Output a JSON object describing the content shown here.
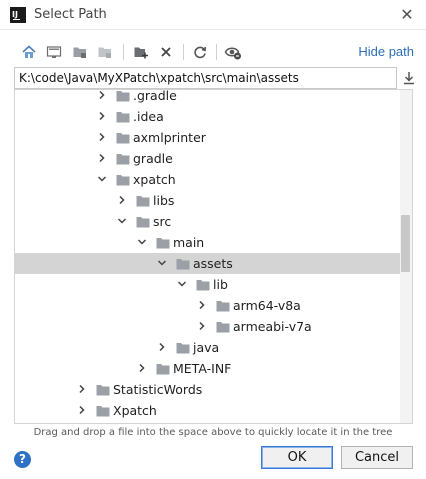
{
  "window": {
    "app_icon_text": "IJ",
    "title": "Select Path",
    "close_glyph": "✕"
  },
  "toolbar": {
    "buttons": [
      {
        "icon": "home-icon",
        "enabled": true
      },
      {
        "icon": "desktop-icon",
        "enabled": true
      },
      {
        "icon": "project-folder-icon",
        "enabled": false
      },
      {
        "icon": "module-folder-icon",
        "enabled": false
      },
      {
        "icon": "new-folder-icon",
        "enabled": true
      },
      {
        "icon": "delete-icon",
        "enabled": true
      },
      {
        "icon": "refresh-icon",
        "enabled": true
      },
      {
        "icon": "show-hidden-files-icon",
        "enabled": true
      }
    ],
    "hide_path_label": "Hide path"
  },
  "path": {
    "value": "K:\\code\\Java\\MyXPatch\\xpatch\\src\\main\\assets"
  },
  "tree": {
    "items": [
      {
        "label": ".gradle",
        "depth": 0,
        "expanded": false,
        "selected": false
      },
      {
        "label": ".idea",
        "depth": 0,
        "expanded": false,
        "selected": false
      },
      {
        "label": "axmlprinter",
        "depth": 0,
        "expanded": false,
        "selected": false
      },
      {
        "label": "gradle",
        "depth": 0,
        "expanded": false,
        "selected": false
      },
      {
        "label": "xpatch",
        "depth": 0,
        "expanded": true,
        "selected": false
      },
      {
        "label": "libs",
        "depth": 1,
        "expanded": false,
        "selected": false
      },
      {
        "label": "src",
        "depth": 1,
        "expanded": true,
        "selected": false
      },
      {
        "label": "main",
        "depth": 2,
        "expanded": true,
        "selected": false
      },
      {
        "label": "assets",
        "depth": 3,
        "expanded": true,
        "selected": true
      },
      {
        "label": "lib",
        "depth": 4,
        "expanded": true,
        "selected": false
      },
      {
        "label": "arm64-v8a",
        "depth": 5,
        "expanded": false,
        "selected": false
      },
      {
        "label": "armeabi-v7a",
        "depth": 5,
        "expanded": false,
        "selected": false
      },
      {
        "label": "java",
        "depth": 3,
        "expanded": false,
        "selected": false
      },
      {
        "label": "META-INF",
        "depth": 2,
        "expanded": false,
        "selected": false
      },
      {
        "label": "StatisticWords",
        "depth": -1,
        "expanded": false,
        "selected": false
      },
      {
        "label": "Xpatch",
        "depth": -1,
        "expanded": false,
        "selected": false
      }
    ]
  },
  "hint_text": "Drag and drop a file into the space above to quickly locate it in the tree",
  "footer": {
    "help_glyph": "?",
    "ok_label": "OK",
    "cancel_label": "Cancel"
  },
  "colors": {
    "accent": "#2b6fb6",
    "selection": "#d4d4d4",
    "folder": "#9aa0a6"
  }
}
